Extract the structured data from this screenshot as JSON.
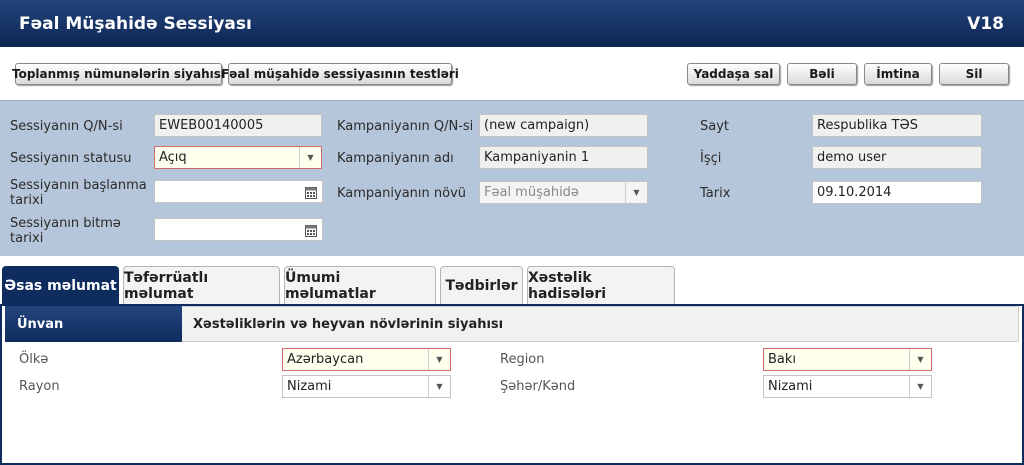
{
  "titlebar": {
    "title": "Fəal Müşahidə Sessiyası",
    "version": "V18"
  },
  "toolbar": {
    "samples_list": "Toplanmış nümunələrin siyahısı",
    "session_tests": "Fəal müşahidə sessiyasının testləri",
    "save": "Yaddaşa sal",
    "ok": "Bəli",
    "cancel": "İmtina",
    "delete": "Sil"
  },
  "form": {
    "session_id_label": "Sessiyanın Q/N-si",
    "session_id_value": "EWEB00140005",
    "status_label": "Sessiyanın statusu",
    "status_value": "Açıq",
    "start_label": "Sessiyanın başlanma tarixi",
    "start_value": "",
    "end_label": "Sessiyanın bitmə tarixi",
    "end_value": "",
    "campaign_id_label": "Kampaniyanın Q/N-si",
    "campaign_id_value": "(new campaign)",
    "campaign_name_label": "Kampaniyanın adı",
    "campaign_name_value": "Kampaniyanin 1",
    "campaign_type_label": "Kampaniyanın növü",
    "campaign_type_value": "Fəal müşahidə",
    "site_label": "Sayt",
    "site_value": "Respublika TƏS",
    "worker_label": "İşçi",
    "worker_value": "demo user",
    "date_label": "Tarix",
    "date_value": "09.10.2014"
  },
  "tabs": [
    {
      "label": "Əsas məlumat"
    },
    {
      "label": "Təfərrüatlı məlumat"
    },
    {
      "label": "Ümumi məlumatlar"
    },
    {
      "label": "Tədbirlər"
    },
    {
      "label": "Xəstəlik hadisələri"
    }
  ],
  "subtabs": {
    "address": "Ünvan",
    "diseases": "Xəstəliklərin və heyvan növlərinin siyahısı"
  },
  "address": {
    "country_label": "Ölkə",
    "country_value": "Azərbaycan",
    "region_label": "Region",
    "region_value": "Bakı",
    "district_label": "Rayon",
    "district_value": "Nizami",
    "city_label": "Şəhər/Kənd",
    "city_value": "Nizami"
  },
  "colors": {
    "header": "#0f2c5e",
    "panel": "#b6c6da",
    "required_border": "#d46a6a"
  }
}
